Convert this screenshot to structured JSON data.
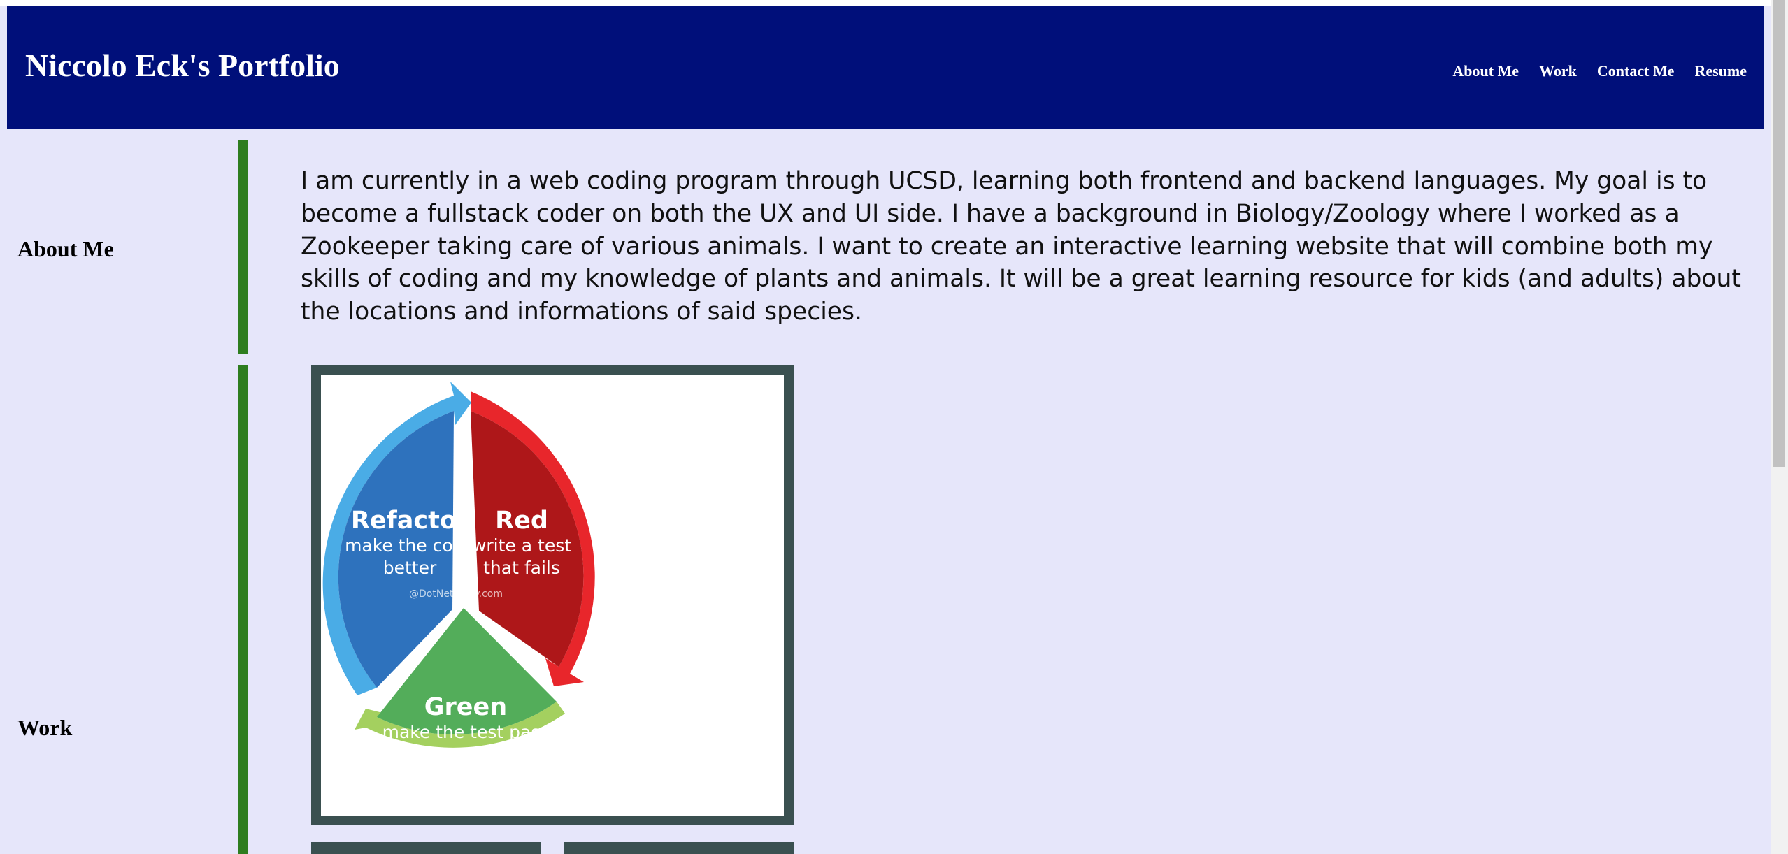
{
  "header": {
    "title": "Niccolo Eck's Portfolio",
    "nav": [
      "About Me",
      "Work",
      "Contact Me",
      "Resume"
    ]
  },
  "about": {
    "label": "About Me",
    "text": "I am currently in a web coding program through UCSD, learning both frontend and backend languages. My goal is to become a fullstack coder on both the UX and UI side. I have a background in Biology/Zoology where I worked as a Zookeeper taking care of various animals. I want to create an interactive learning website that will combine both my skills of coding and my knowledge of plants and animals. It will be a great learning resource for kids (and adults) about the locations and informations of said species."
  },
  "work": {
    "label": "Work",
    "project_image": {
      "segments": [
        {
          "title": "Refactor",
          "line1": "make the code",
          "line2": "better"
        },
        {
          "title": "Red",
          "line1": "write a test",
          "line2": "that fails"
        },
        {
          "title": "Green",
          "line1": "make the test pass",
          "line2": ""
        }
      ],
      "watermark": "@DotNetCurry.com"
    }
  },
  "colors": {
    "header_bg": "#000f7a",
    "page_bg": "#e6e6fa",
    "divider": "#2e7d1f",
    "card_border": "#3a5050"
  }
}
